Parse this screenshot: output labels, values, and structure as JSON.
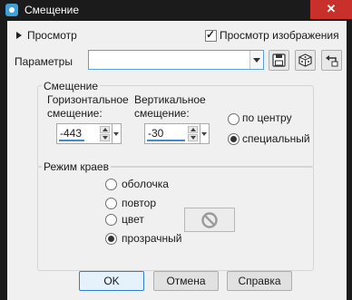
{
  "window": {
    "title": "Смещение",
    "close_label": "✕"
  },
  "preview": {
    "toggle_label": "Просмотр",
    "image_preview_label": "Просмотр изображения",
    "image_preview_checked": true
  },
  "params": {
    "label": "Параметры",
    "value": ""
  },
  "offset": {
    "group_title": "Смещение",
    "horizontal_label_line1": "Горизонтальное",
    "horizontal_label_line2": "смещение:",
    "horizontal_value": "-443",
    "vertical_label_line1": "Вертикальное",
    "vertical_label_line2": "смещение:",
    "vertical_value": "-30",
    "center_label": "по центру",
    "custom_label": "специальный",
    "selected": "custom"
  },
  "edge_mode": {
    "group_title": "Режим краев",
    "options": [
      "оболочка",
      "повтор",
      "цвет",
      "прозрачный"
    ],
    "selected": "прозрачный"
  },
  "buttons": {
    "ok": "OK",
    "cancel": "Отмена",
    "help": "Справка"
  },
  "colors": {
    "accent": "#3d8ad8",
    "close": "#c9302c",
    "titlebar": "#1b1b1b"
  }
}
